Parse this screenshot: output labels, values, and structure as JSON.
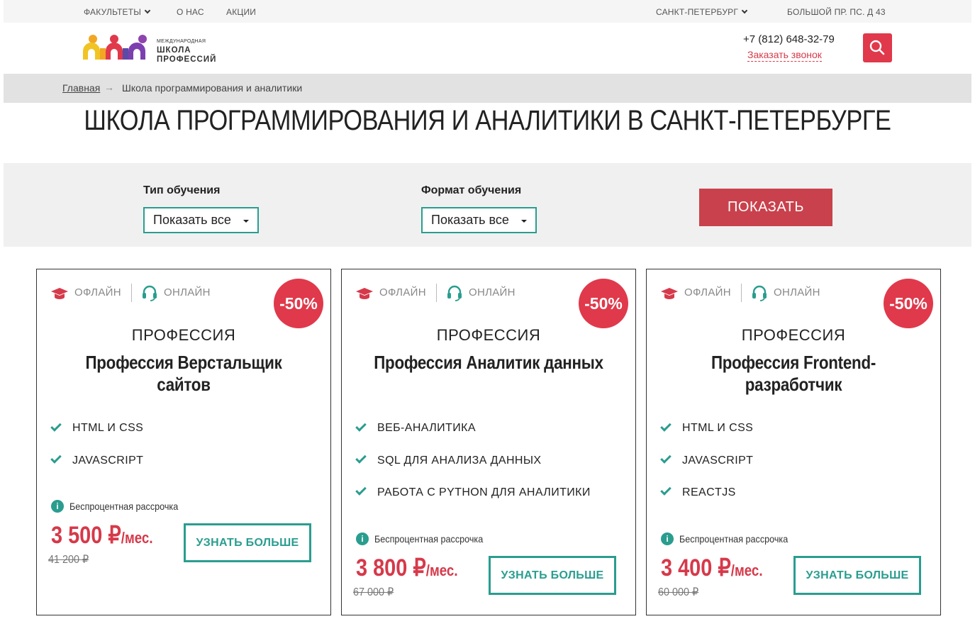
{
  "topbar": {
    "faculties": "ФАКУЛЬТЕТЫ",
    "about": "О НАС",
    "promotions": "АКЦИИ",
    "city": "САНКТ-ПЕТЕРБУРГ",
    "address": "БОЛЬШОЙ ПР. ПС. Д 43"
  },
  "logo": {
    "line1": "МЕЖДУНАРОДНАЯ",
    "line2": "ШКОЛА",
    "line3": "ПРОФЕССИЙ"
  },
  "header": {
    "phone": "+7 (812) 648-32-79",
    "callback": "Заказать звонок"
  },
  "breadcrumb": {
    "home": "Главная",
    "arrow": "→",
    "current": "Школа программирования и аналитики"
  },
  "page_title": "ШКОЛА ПРОГРАММИРОВАНИЯ И АНАЛИТИКИ В САНКТ-ПЕТЕРБУРГЕ",
  "filter": {
    "type_label": "Тип обучения",
    "type_value": "Показать все",
    "format_label": "Формат обучения",
    "format_value": "Показать все",
    "show_button": "ПОКАЗАТЬ"
  },
  "cards": [
    {
      "offline": "ОФЛАЙН",
      "online": "ОНЛАЙН",
      "discount": "-50%",
      "label": "ПРОФЕССИЯ",
      "title": "Профессия Верстальщик сайтов",
      "features": [
        "HTML И CSS",
        "JAVASCRIPT"
      ],
      "installment": "Беспроцентная рассрочка",
      "price": "3 500 ₽",
      "unit": "/мес.",
      "old_price": "41 200 ₽",
      "button": "УЗНАТЬ БОЛЬШЕ"
    },
    {
      "offline": "ОФЛАЙН",
      "online": "ОНЛАЙН",
      "discount": "-50%",
      "label": "ПРОФЕССИЯ",
      "title": "Профессия Аналитик данных",
      "features": [
        "ВЕБ-АНАЛИТИКА",
        "SQL ДЛЯ АНАЛИЗА ДАННЫХ",
        "РАБОТА С PYTHON ДЛЯ АНАЛИТИКИ"
      ],
      "installment": "Беспроцентная рассрочка",
      "price": "3 800 ₽",
      "unit": "/мес.",
      "old_price": "67 000 ₽",
      "button": "УЗНАТЬ БОЛЬШЕ"
    },
    {
      "offline": "ОФЛАЙН",
      "online": "ОНЛАЙН",
      "discount": "-50%",
      "label": "ПРОФЕССИЯ",
      "title": "Профессия Frontend-разработчик",
      "features": [
        "HTML И CSS",
        "JAVASCRIPT",
        "REACTJS"
      ],
      "installment": "Беспроцентная рассрочка",
      "price": "3 400 ₽",
      "unit": "/мес.",
      "old_price": "60 000 ₽",
      "button": "УЗНАТЬ БОЛЬШЕ"
    }
  ],
  "colors": {
    "accent_red": "#e0394b",
    "accent_teal": "#2a9d8f",
    "button_red": "#c9414c"
  }
}
